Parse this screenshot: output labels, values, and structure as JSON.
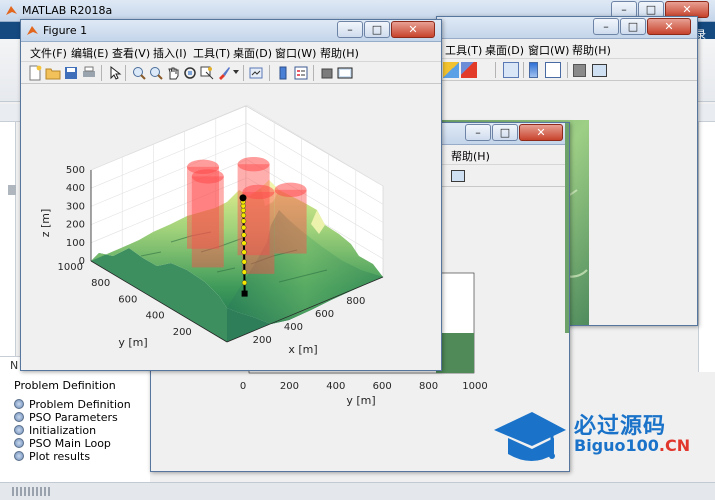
{
  "colors": {
    "desktop": "#1f5f9f",
    "titlebar": "#c4d5ea",
    "figure_bg": "#f0f0f0",
    "cylinder": "#ff4b4b",
    "path": "#000000",
    "waypoint": "#f5e600"
  },
  "matlab": {
    "title": "MATLAB R2018a",
    "right_partial_label": "登录",
    "panel_label": "Problem Definition",
    "panel_header_partial": "N",
    "tree_items": [
      "Problem Definition",
      "PSO Parameters",
      "Initialization",
      "PSO Main Loop",
      "Plot results"
    ]
  },
  "figure": {
    "title": "Figure 1",
    "menu": [
      "文件(F)",
      "编辑(E)",
      "查看(V)",
      "插入(I)",
      "工具(T)",
      "桌面(D)",
      "窗口(W)",
      "帮助(H)"
    ],
    "toolbar_icons": [
      "new-file-icon",
      "open-folder-icon",
      "save-icon",
      "print-icon",
      "pointer-icon",
      "zoom-in-icon",
      "zoom-out-icon",
      "pan-icon",
      "rotate-3d-icon",
      "data-cursor-icon",
      "brush-icon",
      "link-plot-icon",
      "colorbar-icon",
      "legend-icon",
      "hide-plot-tools-icon",
      "show-plot-tools-icon"
    ]
  },
  "back_figure": {
    "menu": [
      "工具(T)",
      "桌面(D)",
      "窗口(W)",
      "帮助(H)"
    ]
  },
  "middle_figure": {
    "menu": [
      "帮助(H)"
    ]
  },
  "watermark": {
    "brand_cn": "必过源码",
    "brand_en": "Biguo100",
    "brand_tld": ".CN"
  },
  "chart_data": [
    {
      "type": "surface3d",
      "xlabel": "x [m]",
      "ylabel": "y [m]",
      "zlabel": "z [m]",
      "xlim": [
        0,
        1000
      ],
      "ylim": [
        0,
        1000
      ],
      "zlim": [
        0,
        500
      ],
      "x_ticks": [
        "200",
        "400",
        "600",
        "800"
      ],
      "y_ticks": [
        "200",
        "400",
        "600",
        "800",
        "1000"
      ],
      "z_ticks": [
        "0",
        "100",
        "200",
        "300",
        "400",
        "500"
      ],
      "surface": "terrain (colormap summer)",
      "obstacles": [
        {
          "name": "cylinder",
          "x": 400,
          "y": 600,
          "r": 80,
          "height": 500
        },
        {
          "name": "cylinder",
          "x": 500,
          "y": 750,
          "r": 80,
          "height": 450
        },
        {
          "name": "cylinder",
          "x": 650,
          "y": 550,
          "r": 80,
          "height": 500
        },
        {
          "name": "cylinder",
          "x": 550,
          "y": 400,
          "r": 80,
          "height": 450
        },
        {
          "name": "cylinder",
          "x": 800,
          "y": 450,
          "r": 80,
          "height": 350
        }
      ],
      "path": {
        "start": {
          "x": 200,
          "y": 100,
          "z": 150
        },
        "goal": {
          "x": 800,
          "y": 800,
          "z": 150
        },
        "waypoints": 12
      }
    },
    {
      "type": "image",
      "xlabel": "y [m]",
      "x_ticks": [
        "0",
        "200",
        "400",
        "600",
        "800",
        "1000"
      ]
    }
  ]
}
